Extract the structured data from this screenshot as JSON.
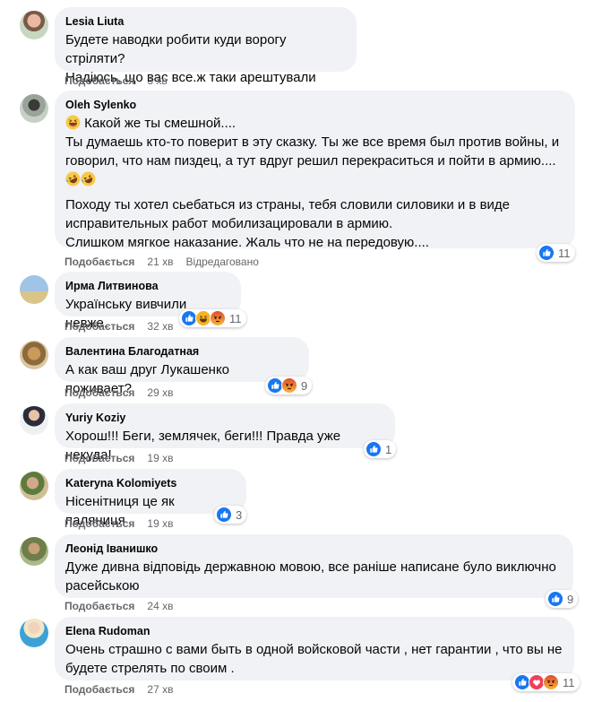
{
  "labels": {
    "like": "Подобається",
    "edited": "Відредаговано"
  },
  "comments": [
    {
      "author": "Lesia Liuta",
      "lines": [
        "Будете наводки робити куди ворогу стріляти?",
        "Надіюсь, що вас все.ж таки арештували"
      ],
      "time": "3 хв"
    },
    {
      "author": "Oleh Sylenko",
      "line1": "Какой же ты смешной....",
      "line2": "Ты думаешь кто-то поверит в эту сказку. Ты же все время был против войны, и",
      "line3": "говорил, что нам пиздец, а тут вдруг решил перекраситься и пойти в армию....",
      "line5": "Походу ты хотел сьебаться из страны, тебя словили силовики и в виде",
      "line6": "исправительных работ мобилизацировали в армию.",
      "line7": "Слишком мягкое наказание. Жаль что не на передовую....",
      "time": "21 хв",
      "edited": true,
      "reaction_count": "11"
    },
    {
      "author": "Ирма Литвинова",
      "lines": [
        "Українську вивчили невже."
      ],
      "time": "32 хв",
      "reaction_count": "11"
    },
    {
      "author": "Валентина Благодатная",
      "lines": [
        "А как ваш друг Лукашенко поживает?"
      ],
      "time": "29 хв",
      "reaction_count": "9"
    },
    {
      "author": "Yuriy Koziy",
      "lines": [
        "Хорош!!! Беги, землячек, беги!!! Правда уже некуда!"
      ],
      "time": "19 хв",
      "reaction_count": "1"
    },
    {
      "author": "Kateryna Kolomiyets",
      "lines": [
        "Нісенітниця це як паляниця"
      ],
      "time": "19 хв",
      "reaction_count": "3"
    },
    {
      "author": "Леонід Іванишко",
      "lines": [
        "Дуже дивна відповідь державною мовою, все раніше написане було виключно",
        "расейською"
      ],
      "time": "24 хв",
      "reaction_count": "9"
    },
    {
      "author": "Elena Rudoman",
      "lines": [
        "Очень страшно с вами быть в одной войсковой части , нет гарантии , что вы не",
        "будете стрелять по своим ."
      ],
      "time": "27 хв",
      "reaction_count": "11"
    }
  ],
  "colors": {
    "like_blue": "#1877f2",
    "angry": "#f5a623",
    "haha": "#f7b125",
    "love": "#f33e58",
    "bubble": "#f0f2f5",
    "meta": "#65676b"
  }
}
